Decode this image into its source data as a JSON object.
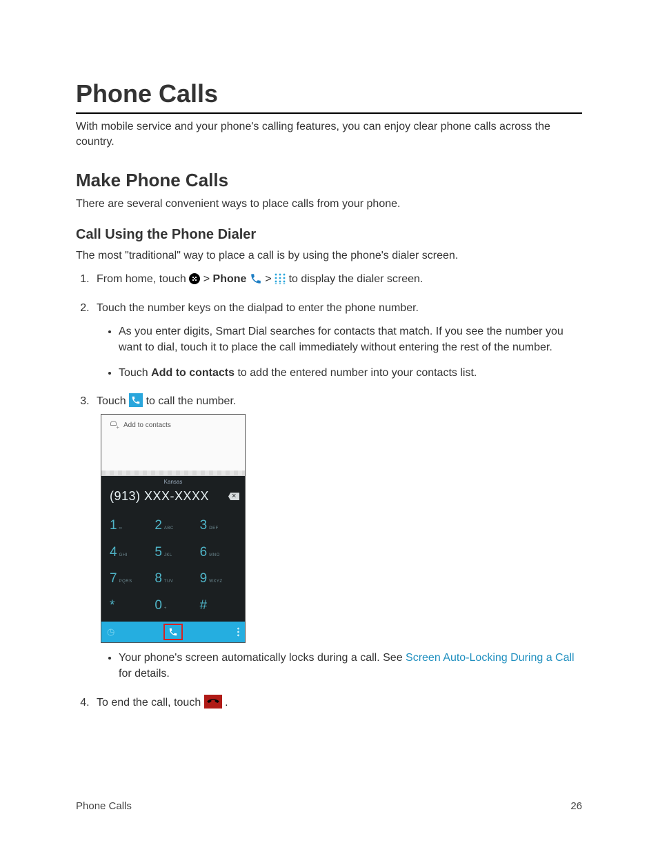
{
  "heading": "Phone Calls",
  "intro": "With mobile service and your phone's calling features, you can enjoy clear phone calls across the country.",
  "section2": "Make Phone Calls",
  "section2_intro": "There are several convenient ways to place calls from your phone.",
  "section3": "Call Using the Phone Dialer",
  "section3_intro": "The most \"traditional\" way to place a call is by using the phone's dialer screen.",
  "step1": {
    "pre": "From home, touch ",
    "gt1": " > ",
    "phone": "Phone",
    "gt2": " > ",
    "post": " to display the dialer screen."
  },
  "step2": "Touch the number keys on the dialpad to enter the phone number.",
  "step2_b1": "As you enter digits, Smart Dial searches for contacts that match. If you see the number you want to dial, touch it to place the call immediately without entering the rest of the number.",
  "step2_b2a": "Touch ",
  "step2_b2bold": "Add to contacts",
  "step2_b2b": " to add the entered number into your contacts list.",
  "step3_a": "Touch ",
  "step3_b": " to call the number.",
  "step3_note_a": "Your phone's screen automatically locks during a call. See ",
  "step3_link": "Screen Auto-Locking During a Call",
  "step3_note_b": " for details.",
  "step4_a": "To end the call, touch ",
  "step4_b": ".",
  "screenshot": {
    "add_contacts": "Add to contacts",
    "location": "Kansas",
    "number": "(913) XXX-XXXX",
    "keys": [
      {
        "d": "1",
        "l": "∞"
      },
      {
        "d": "2",
        "l": "ABC"
      },
      {
        "d": "3",
        "l": "DEF"
      },
      {
        "d": "4",
        "l": "GHI"
      },
      {
        "d": "5",
        "l": "JKL"
      },
      {
        "d": "6",
        "l": "MNO"
      },
      {
        "d": "7",
        "l": "PQRS"
      },
      {
        "d": "8",
        "l": "TUV"
      },
      {
        "d": "9",
        "l": "WXYZ"
      },
      {
        "d": "*",
        "l": ""
      },
      {
        "d": "0",
        "l": "+"
      },
      {
        "d": "#",
        "l": ""
      }
    ]
  },
  "footer_left": "Phone Calls",
  "footer_right": "26"
}
